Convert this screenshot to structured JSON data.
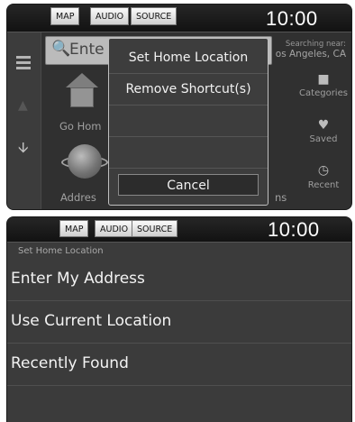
{
  "top_screen": {
    "status_bar": {
      "map_label": "MAP",
      "audio_label": "AUDIO",
      "source_label": "SOURCE",
      "clock": "10:00"
    },
    "search": {
      "placeholder_visible": "Ente"
    },
    "searching_near": {
      "label": "Searching near:",
      "location": "os Angeles, CA"
    },
    "tiles": {
      "go_home": "Go Hom",
      "address": "Addres",
      "partial": "ns"
    },
    "right_col": {
      "categories": "Categories",
      "saved": "Saved",
      "recent": "Recent"
    },
    "popup": {
      "items": [
        "Set Home Location",
        "Remove Shortcut(s)"
      ],
      "cancel": "Cancel"
    }
  },
  "bottom_screen": {
    "status_bar": {
      "map_label": "MAP",
      "audio_label": "AUDIO",
      "source_label": "SOURCE",
      "clock": "10:00"
    },
    "heading": "Set Home Location",
    "options": [
      "Enter My Address",
      "Use Current Location",
      "Recently Found"
    ]
  },
  "icons": {
    "menu": "hamburger-icon",
    "search": "search-icon",
    "down": "down-arrow-icon",
    "categories": "categories-icon",
    "saved": "heart-icon",
    "recent": "clock-icon"
  }
}
